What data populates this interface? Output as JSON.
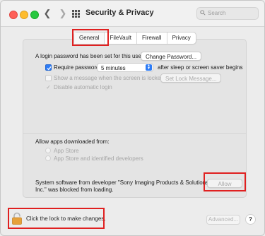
{
  "window": {
    "title": "Security & Privacy",
    "search_placeholder": "Search"
  },
  "tabs": [
    {
      "label": "General",
      "active": true
    },
    {
      "label": "FileVault",
      "active": false
    },
    {
      "label": "Firewall",
      "active": false
    },
    {
      "label": "Privacy",
      "active": false
    }
  ],
  "general": {
    "login_text": "A login password has been set for this user",
    "change_password_label": "Change Password...",
    "require_password_label": "Require password",
    "require_password_checked": true,
    "require_password_value": "5 minutes",
    "after_sleep_text": "after sleep or screen saver begins",
    "show_message_label": "Show a message when the screen is locked",
    "set_lock_message_label": "Set Lock Message...",
    "disable_auto_login_label": "Disable automatic login"
  },
  "allow_apps": {
    "heading": "Allow apps downloaded from:",
    "options": [
      "App Store",
      "App Store and identified developers"
    ]
  },
  "blocked": {
    "message": "System software from developer \"Sony Imaging Products & Solutions Inc.\" was blocked from loading.",
    "allow_label": "Allow"
  },
  "footer": {
    "lock_text": "Click the lock to make changes.",
    "advanced_label": "Advanced...",
    "help_label": "?"
  },
  "colors": {
    "highlight": "#e02020",
    "accent": "#2d7cf6",
    "lock": "#e6a13a"
  }
}
